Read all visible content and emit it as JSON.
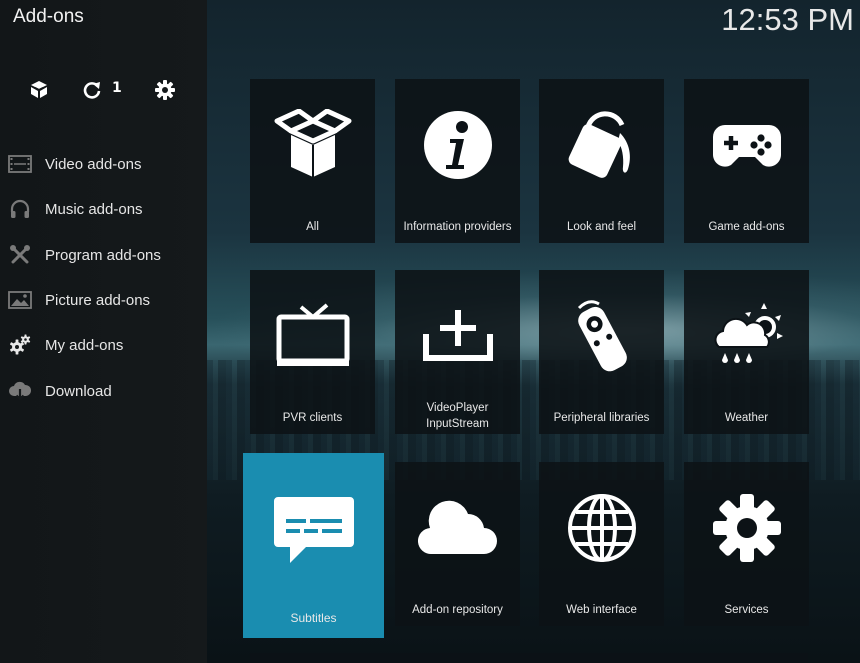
{
  "header": {
    "title": "Add-ons",
    "clock": "12:53 PM"
  },
  "toolbar": {
    "addon_browser_icon": "open-box-icon",
    "updates_icon": "refresh-icon",
    "updates_count": "1",
    "settings_icon": "gear-icon"
  },
  "sidebar": {
    "items": [
      {
        "label": "Video add-ons",
        "icon": "film-strip-icon"
      },
      {
        "label": "Music add-ons",
        "icon": "headphones-icon"
      },
      {
        "label": "Program add-ons",
        "icon": "tools-icon"
      },
      {
        "label": "Picture add-ons",
        "icon": "picture-icon"
      },
      {
        "label": "My add-ons",
        "icon": "gears-icon"
      },
      {
        "label": "Download",
        "icon": "cloud-download-icon"
      }
    ]
  },
  "grid": {
    "tiles": [
      {
        "label": "All",
        "icon": "open-box-icon"
      },
      {
        "label": "Information providers",
        "icon": "info-icon"
      },
      {
        "label": "Look and feel",
        "icon": "paint-bucket-icon"
      },
      {
        "label": "Game add-ons",
        "icon": "gamepad-icon"
      },
      {
        "label": "PVR clients",
        "icon": "tv-icon"
      },
      {
        "label": "VideoPlayer InputStream",
        "icon": "tray-add-icon"
      },
      {
        "label": "Peripheral libraries",
        "icon": "remote-control-icon"
      },
      {
        "label": "Weather",
        "icon": "weather-icon"
      },
      {
        "label": "Subtitles",
        "icon": "speech-bubble-icon",
        "selected": true
      },
      {
        "label": "Add-on repository",
        "icon": "cloud-icon"
      },
      {
        "label": "Web interface",
        "icon": "globe-icon"
      },
      {
        "label": "Services",
        "icon": "gear-icon"
      }
    ],
    "selected_color": "#1a8db0"
  }
}
